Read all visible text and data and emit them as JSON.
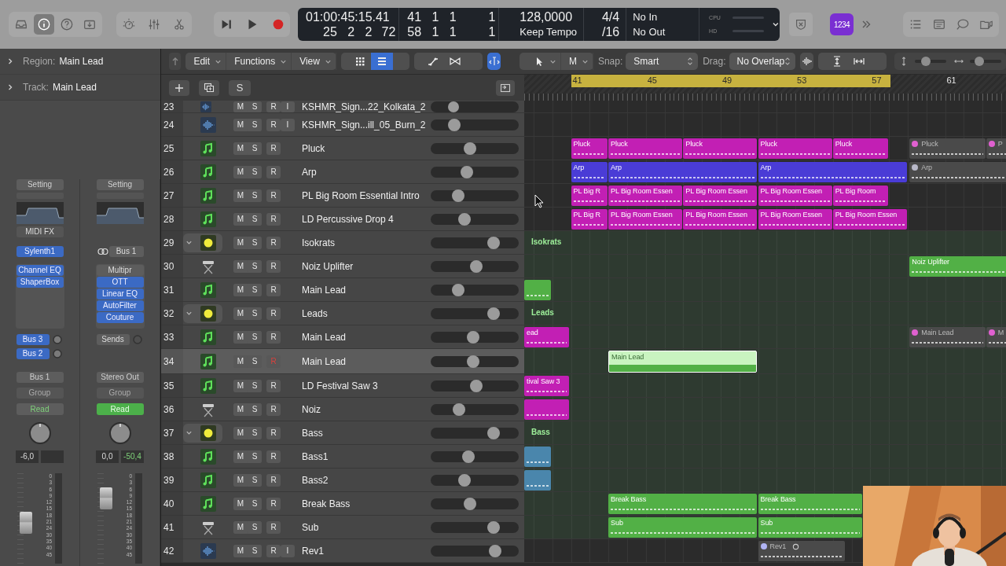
{
  "top_bar": {
    "buttons": [
      {
        "kind": "library",
        "selected": false
      },
      {
        "kind": "info",
        "selected": true
      },
      {
        "kind": "help",
        "selected": false
      },
      {
        "kind": "download",
        "selected": false
      }
    ],
    "view_buttons": [
      {
        "kind": "smart-controls",
        "selected": false
      },
      {
        "kind": "mixer",
        "selected": false
      },
      {
        "kind": "editors",
        "selected": false
      }
    ],
    "transport": [
      {
        "kind": "forward"
      },
      {
        "kind": "play"
      },
      {
        "kind": "record"
      }
    ],
    "lcd": {
      "time": "01:00:45:15.41",
      "beats": "25 2 2",
      "ticks": "72",
      "locator_left": "41 1 1",
      "locator_right": "58 1 1",
      "left_extra": "1",
      "right_extra": "1",
      "tempo": "128,0000",
      "tempo_mode": "Keep Tempo",
      "signature": "4/4",
      "division": "/16",
      "midi_in": "No In",
      "midi_out": "No Out",
      "cpu": "CPU",
      "hd": "HD"
    },
    "count_in": "1234",
    "right_buttons": [
      {
        "kind": "list"
      },
      {
        "kind": "notepad"
      },
      {
        "kind": "loops"
      },
      {
        "kind": "browser"
      }
    ]
  },
  "inspector": {
    "region": {
      "label": "Region:",
      "value": "Main Lead"
    },
    "track": {
      "label": "Track:",
      "value": "Main Lead"
    }
  },
  "strips": [
    {
      "setting": "Setting",
      "midi_fx": "MIDI FX",
      "input": {
        "label": "Sylenth1",
        "linked": false
      },
      "inserts": [
        {
          "label": "Channel EQ",
          "on": true
        },
        {
          "label": "ShaperBox",
          "on": true
        }
      ],
      "sends": [
        {
          "label": "Bus 3",
          "on": true
        },
        {
          "label": "Bus 2",
          "on": true
        }
      ],
      "output": "Bus 1",
      "group": "Group",
      "automation": {
        "label": "Read",
        "on": false
      },
      "volume": "-6,0",
      "fader": {
        "level": 0.45
      },
      "scale": [
        "0",
        "3",
        "6",
        "9",
        "12",
        "15",
        "18",
        "21",
        "24",
        "30",
        "35",
        "40",
        "45"
      ]
    },
    {
      "setting": "Setting",
      "input": {
        "label": "Bus 1",
        "linked": true
      },
      "inserts": [
        {
          "label": "Multipr",
          "on": false
        },
        {
          "label": "OTT",
          "on": true
        },
        {
          "label": "Linear EQ",
          "on": true
        },
        {
          "label": "AutoFilter",
          "on": true
        },
        {
          "label": "Couture",
          "on": true
        }
      ],
      "sends": [
        {
          "label": "Sends",
          "on": false
        }
      ],
      "output": "Stereo Out",
      "group": "Group",
      "automation": {
        "label": "Read",
        "on": true
      },
      "volume": "0,0",
      "peak": "-50,4",
      "fader": {
        "level": 0.72
      },
      "scale": [
        "0",
        "3",
        "6",
        "9",
        "12",
        "15",
        "18",
        "21",
        "24",
        "30",
        "35",
        "40",
        "45"
      ]
    }
  ],
  "toolbar": {
    "menus": [
      "Edit",
      "Functions",
      "View"
    ],
    "view_buttons": [
      {
        "kind": "grid",
        "selected": false
      },
      {
        "kind": "list",
        "selected": true
      }
    ],
    "catch": {
      "selected": true
    },
    "tool": "M",
    "snap_label": "Snap:",
    "snap": "Smart",
    "drag_label": "Drag:",
    "drag": "No Overlap",
    "zoom_sliders": [
      {
        "kind": "vertical",
        "level": 0.35
      },
      {
        "kind": "horizontal",
        "level": 0.3
      }
    ]
  },
  "track_header_bar": {
    "solo_button": "S"
  },
  "ruler": {
    "bars": [
      "41",
      "45",
      "49",
      "53",
      "57",
      "61"
    ],
    "cycle": true
  },
  "tracks": [
    {
      "number": "23",
      "name": "KSHMR_Sign...22_Kolkata_2",
      "kind": "audio",
      "mute": "M",
      "solo": "S",
      "record": "R",
      "input": "I",
      "level": 0.27,
      "selected": false,
      "armed": false
    },
    {
      "number": "24",
      "name": "KSHMR_Sign...ill_05_Burn_2",
      "kind": "audio",
      "mute": "M",
      "solo": "S",
      "record": "R",
      "input": "I",
      "level": 0.27,
      "selected": false,
      "armed": false
    },
    {
      "number": "25",
      "name": "Pluck",
      "kind": "midi",
      "mute": "M",
      "solo": "S",
      "record": "R",
      "level": 0.45,
      "selected": false,
      "armed": false,
      "regions": [
        {
          "label": "Pluck",
          "color": "#c21fb4",
          "muted": false,
          "selected": false
        },
        {
          "label": "Pluck",
          "color": "#c21fb4",
          "muted": false,
          "selected": false
        },
        {
          "label": "Pluck",
          "color": "#c21fb4",
          "muted": false,
          "selected": false
        },
        {
          "label": "Pluck",
          "color": "#c21fb4",
          "muted": false,
          "selected": false
        },
        {
          "label": "Pluck",
          "color": "#c21fb4",
          "muted": false,
          "selected": false
        },
        {
          "label": "Pluck",
          "color": "#e060d0",
          "muted": true,
          "selected": false
        },
        {
          "label": "P",
          "color": "#e060d0",
          "muted": true,
          "selected": false
        }
      ]
    },
    {
      "number": "26",
      "name": "Arp",
      "kind": "midi",
      "mute": "M",
      "solo": "S",
      "record": "R",
      "level": 0.41,
      "selected": false,
      "armed": false,
      "regions": [
        {
          "label": "Arp",
          "color": "#4a3cd6",
          "muted": false,
          "selected": false
        },
        {
          "label": "Arp",
          "color": "#4a3cd6",
          "muted": false,
          "selected": false
        },
        {
          "label": "Arp",
          "color": "#4a3cd6",
          "muted": false,
          "selected": false
        },
        {
          "label": "Arp",
          "color": "#b8b8c8",
          "muted": true,
          "selected": false
        }
      ]
    },
    {
      "number": "27",
      "name": "PL Big Room Essential Intro",
      "kind": "midi",
      "mute": "M",
      "solo": "S",
      "record": "R",
      "level": 0.31,
      "selected": false,
      "armed": false,
      "regions": [
        {
          "label": "PL Big R",
          "color": "#c21fb4",
          "muted": false,
          "selected": false
        },
        {
          "label": "PL Big Room Essen",
          "color": "#c21fb4",
          "muted": false,
          "selected": false
        },
        {
          "label": "PL Big Room Essen",
          "color": "#c21fb4",
          "muted": false,
          "selected": false
        },
        {
          "label": "PL Big Room Essen",
          "color": "#c21fb4",
          "muted": false,
          "selected": false
        },
        {
          "label": "PL Big Room",
          "color": "#c21fb4",
          "muted": false,
          "selected": false
        }
      ]
    },
    {
      "number": "28",
      "name": "LD Percussive Drop 4",
      "kind": "midi",
      "mute": "M",
      "solo": "S",
      "record": "R",
      "level": 0.38,
      "selected": false,
      "armed": false,
      "regions": [
        {
          "label": "PL Big R",
          "color": "#c21fb4",
          "muted": false,
          "selected": false
        },
        {
          "label": "PL Big Room Essen",
          "color": "#c21fb4",
          "muted": false,
          "selected": false
        },
        {
          "label": "PL Big Room Essen",
          "color": "#c21fb4",
          "muted": false,
          "selected": false
        },
        {
          "label": "PL Big Room Essen",
          "color": "#c21fb4",
          "muted": false,
          "selected": false
        },
        {
          "label": "PL Big Room Essen",
          "color": "#c21fb4",
          "muted": false,
          "selected": false
        }
      ]
    },
    {
      "number": "29",
      "name": "Isokrats",
      "kind": "summing",
      "mute": "M",
      "solo": "S",
      "record": "R",
      "level": 0.71,
      "selected": false,
      "armed": false,
      "expanded": true,
      "lane_label": "Isokrats",
      "children": [
        {
          "number": "30",
          "name": "Noiz Uplifter",
          "kind": "instrument",
          "mute": "M",
          "solo": "S",
          "record": "R",
          "level": 0.52,
          "selected": false,
          "armed": false,
          "regions": [
            {
              "label": "Noiz Uplifter",
              "color": "#52b046",
              "muted": false,
              "selected": false
            }
          ]
        },
        {
          "number": "31",
          "name": "Main Lead",
          "kind": "midi",
          "mute": "M",
          "solo": "S",
          "record": "R",
          "level": 0.31,
          "selected": false,
          "armed": false,
          "regions": [
            {
              "color": "#52b046",
              "muted": false,
              "selected": false
            }
          ]
        }
      ]
    },
    {
      "number": "32",
      "name": "Leads",
      "kind": "summing",
      "mute": "M",
      "solo": "S",
      "record": "R",
      "level": 0.71,
      "selected": false,
      "armed": false,
      "expanded": true,
      "lane_label": "Leads",
      "children": [
        {
          "number": "33",
          "name": "Main Lead",
          "kind": "midi",
          "mute": "M",
          "solo": "S",
          "record": "R",
          "level": 0.48,
          "selected": false,
          "armed": false,
          "regions": [
            {
              "label": "ead",
              "color": "#c21fb4",
              "muted": false,
              "selected": false
            },
            {
              "label": "Main Lead",
              "color": "#e060d0",
              "muted": true,
              "selected": false
            },
            {
              "label": "M",
              "color": "#e060d0",
              "muted": true,
              "selected": false
            }
          ]
        },
        {
          "number": "34",
          "name": "Main Lead",
          "kind": "midi",
          "mute": "M",
          "solo": "S",
          "record": "R",
          "level": 0.48,
          "selected": true,
          "armed": true,
          "regions": [
            {
              "label": "Main Lead",
              "color": "#52b046",
              "muted": false,
              "selected": true
            }
          ]
        },
        {
          "number": "35",
          "name": "LD Festival Saw 3",
          "kind": "midi",
          "mute": "M",
          "solo": "S",
          "record": "R",
          "level": 0.52,
          "selected": false,
          "armed": false,
          "regions": [
            {
              "label": "tival Saw 3",
              "color": "#c21fb4",
              "muted": false,
              "selected": false
            }
          ]
        },
        {
          "number": "36",
          "name": "Noiz",
          "kind": "instrument",
          "mute": "M",
          "solo": "S",
          "record": "R",
          "level": 0.32,
          "selected": false,
          "armed": false,
          "regions": [
            {
              "color": "#c21fb4",
              "muted": false,
              "selected": false
            }
          ]
        }
      ]
    },
    {
      "number": "37",
      "name": "Bass",
      "kind": "summing",
      "mute": "M",
      "solo": "S",
      "record": "R",
      "level": 0.71,
      "selected": false,
      "armed": false,
      "expanded": true,
      "lane_label": "Bass",
      "children": [
        {
          "number": "38",
          "name": "Bass1",
          "kind": "midi",
          "mute": "M",
          "solo": "S",
          "record": "R",
          "level": 0.43,
          "selected": false,
          "armed": false,
          "regions": [
            {
              "color": "#4a86ac",
              "muted": false,
              "selected": false
            }
          ]
        },
        {
          "number": "39",
          "name": "Bass2",
          "kind": "midi",
          "mute": "M",
          "solo": "S",
          "record": "R",
          "level": 0.38,
          "selected": false,
          "armed": false,
          "regions": [
            {
              "color": "#4a86ac",
              "muted": false,
              "selected": false
            }
          ]
        },
        {
          "number": "40",
          "name": "Break Bass",
          "kind": "midi",
          "mute": "M",
          "solo": "S",
          "record": "R",
          "level": 0.45,
          "selected": false,
          "armed": false,
          "regions": [
            {
              "label": "Break Bass",
              "color": "#52b046",
              "muted": false,
              "selected": false
            },
            {
              "label": "Break Bass",
              "color": "#52b046",
              "muted": false,
              "selected": false
            }
          ]
        },
        {
          "number": "41",
          "name": "Sub",
          "kind": "instrument",
          "mute": "M",
          "solo": "S",
          "record": "R",
          "level": 0.71,
          "selected": false,
          "armed": false,
          "regions": [
            {
              "label": "Sub",
              "color": "#52b046",
              "muted": false,
              "selected": false
            },
            {
              "label": "Sub",
              "color": "#52b046",
              "muted": false,
              "selected": false
            }
          ]
        }
      ]
    },
    {
      "number": "42",
      "name": "Rev1",
      "kind": "audio",
      "mute": "M",
      "solo": "S",
      "record": "R",
      "input": "I",
      "level": 0.73,
      "selected": false,
      "armed": false,
      "regions": [
        {
          "label": "Rev1",
          "color": "#b0b4f4",
          "muted": true,
          "looped": true,
          "selected": false
        }
      ]
    }
  ]
}
